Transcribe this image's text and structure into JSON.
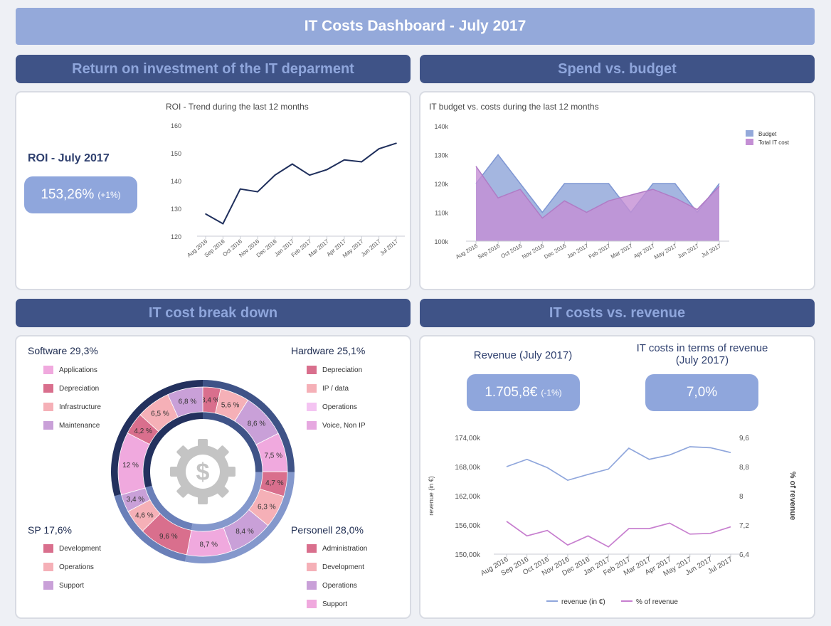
{
  "title": "IT Costs Dashboard - July 2017",
  "sections": {
    "roi": "Return on investment of the IT deparment",
    "spend": "Spend vs. budget",
    "breakdown": "IT cost break down",
    "revenue": "IT costs vs. revenue"
  },
  "roi_kpi": {
    "label": "ROI - July 2017",
    "value": "153,26%",
    "delta": "(+1%)"
  },
  "revenue_kpi": {
    "label": "Revenue (July 2017)",
    "value": "1.705,8€",
    "delta": "(-1%)"
  },
  "share_kpi": {
    "label": "IT costs in terms of revenue (July 2017)",
    "value": "7,0%"
  },
  "colors": {
    "navy": "#3f5387",
    "lavender": "#94a9da",
    "line_dark": "#1f2f5c",
    "budget": "#94a9da",
    "cost": "#c48fd4",
    "revenue_line": "#8fa6dc",
    "pct_line": "#c77fcf"
  },
  "breakdown_groups": {
    "software": {
      "title": "Software 29,3%",
      "items": [
        {
          "label": "Applications",
          "color": "#f0a9de"
        },
        {
          "label": "Depreciation",
          "color": "#d96f8d"
        },
        {
          "label": "Infrastructure",
          "color": "#f5b0b7"
        },
        {
          "label": "Maintenance",
          "color": "#c9a0d8"
        }
      ]
    },
    "hardware": {
      "title": "Hardware 25,1%",
      "items": [
        {
          "label": "Depreciation",
          "color": "#d96f8d"
        },
        {
          "label": "IP / data",
          "color": "#f5b0b7"
        },
        {
          "label": "Operations",
          "color": "#f4c4f2"
        },
        {
          "label": "Voice, Non IP",
          "color": "#e6a8e0"
        }
      ]
    },
    "sp": {
      "title": "SP 17,6%",
      "items": [
        {
          "label": "Development",
          "color": "#d96f8d"
        },
        {
          "label": "Operations",
          "color": "#f5b0b7"
        },
        {
          "label": "Support",
          "color": "#c9a0d8"
        }
      ]
    },
    "personell": {
      "title": "Personell 28,0%",
      "items": [
        {
          "label": "Administration",
          "color": "#d96f8d"
        },
        {
          "label": "Development",
          "color": "#f5b0b7"
        },
        {
          "label": "Operations",
          "color": "#c9a0d8"
        },
        {
          "label": "Support",
          "color": "#f0a9de"
        }
      ]
    }
  },
  "chart_data": [
    {
      "type": "line",
      "title": "ROI - Trend during the last 12 months",
      "categories": [
        "Aug 2016",
        "Sep 2016",
        "Oct 2016",
        "Nov 2016",
        "Dec 2016",
        "Jan 2017",
        "Feb 2017",
        "Mar 2017",
        "Apr 2017",
        "May 2017",
        "Jun 2017",
        "Jul 2017"
      ],
      "series": [
        {
          "values": [
            128,
            124.5,
            137,
            136,
            142,
            146,
            142,
            144,
            147.5,
            146.8,
            151.5,
            153.5
          ]
        }
      ],
      "ylim": [
        120,
        160
      ],
      "yticks": [
        "160",
        "150",
        "140",
        "130",
        "120"
      ]
    },
    {
      "type": "area",
      "title": "IT budget vs. costs during the last 12 months",
      "categories": [
        "Aug 2016",
        "Sep 2016",
        "Oct 2016",
        "Nov 2016",
        "Dec 2016",
        "Jan 2017",
        "Feb 2017",
        "Mar 2017",
        "Apr 2017",
        "May 2017",
        "Jun 2017",
        "Jul 2017"
      ],
      "series": [
        {
          "name": "Budget",
          "values": [
            120000,
            130000,
            120000,
            110000,
            120000,
            120000,
            120000,
            110000,
            120000,
            120000,
            110000,
            120000
          ]
        },
        {
          "name": "Total IT cost",
          "values": [
            126000,
            115000,
            118000,
            108000,
            114000,
            110000,
            114000,
            116000,
            118000,
            115000,
            111000,
            119000
          ]
        }
      ],
      "ylim": [
        100000,
        140000
      ],
      "yticks": [
        "140k",
        "130k",
        "120k",
        "110k",
        "100k"
      ],
      "legend": "top-right"
    },
    {
      "type": "pie",
      "slices": [
        {
          "label": "3,4 %",
          "value": 3.4,
          "color": "#d96f8d"
        },
        {
          "label": "5,6 %",
          "value": 5.6,
          "color": "#f5b0b7"
        },
        {
          "label": "8,6 %",
          "value": 8.6,
          "color": "#c9a0d8"
        },
        {
          "label": "7,5 %",
          "value": 7.5,
          "color": "#f0a9de"
        },
        {
          "label": "4,7 %",
          "value": 4.7,
          "color": "#d96f8d"
        },
        {
          "label": "6,3 %",
          "value": 6.3,
          "color": "#f5b0b7"
        },
        {
          "label": "8,4 %",
          "value": 8.4,
          "color": "#c9a0d8"
        },
        {
          "label": "8,7 %",
          "value": 8.7,
          "color": "#f0a9de"
        },
        {
          "label": "9,6 %",
          "value": 9.6,
          "color": "#d96f8d"
        },
        {
          "label": "4,6 %",
          "value": 4.6,
          "color": "#f5b0b7"
        },
        {
          "label": "3,4 %",
          "value": 3.4,
          "color": "#c9a0d8"
        },
        {
          "label": "12 %",
          "value": 12,
          "color": "#f0a9de"
        },
        {
          "label": "4,2 %",
          "value": 4.2,
          "color": "#d96f8d"
        },
        {
          "label": "6,5 %",
          "value": 6.5,
          "color": "#f5b0b7"
        },
        {
          "label": "6,8 %",
          "value": 6.8,
          "color": "#c9a0d8"
        }
      ],
      "groups": [
        {
          "name": "Hardware",
          "value": 25.1,
          "color": "#3f5387"
        },
        {
          "name": "Personell",
          "value": 28.0,
          "color": "#8498cc"
        },
        {
          "name": "SP",
          "value": 17.6,
          "color": "#6a7fb8"
        },
        {
          "name": "Software",
          "value": 29.3,
          "color": "#23315e"
        }
      ]
    },
    {
      "type": "line",
      "categories": [
        "Aug 2016",
        "Sep 2016",
        "Oct 2016",
        "Nov 2016",
        "Dec 2016",
        "Jan 2017",
        "Feb 2017",
        "Mar 2017",
        "Apr 2017",
        "May 2017",
        "Jun 2017",
        "Jul 2017"
      ],
      "series": [
        {
          "name": "revenue (in €)",
          "axis": "left",
          "values": [
            168000,
            169500,
            167800,
            165200,
            166400,
            167500,
            171800,
            169500,
            170400,
            172100,
            171900,
            170900
          ]
        },
        {
          "name": "% of revenue",
          "axis": "right",
          "values": [
            7.3,
            6.9,
            7.05,
            6.65,
            6.9,
            6.6,
            7.1,
            7.1,
            7.25,
            6.95,
            6.97,
            7.15
          ]
        }
      ],
      "ylabel": "revenue (in €)",
      "y2label": "% of revenue",
      "ylim": [
        150000,
        174000
      ],
      "y2lim": [
        6.4,
        9.6
      ],
      "yticks": [
        "174,00k",
        "168,00k",
        "162,00k",
        "156,00k",
        "150,00k"
      ],
      "y2ticks": [
        "9,6",
        "8,8",
        "8",
        "7,2",
        "6,4"
      ]
    }
  ]
}
